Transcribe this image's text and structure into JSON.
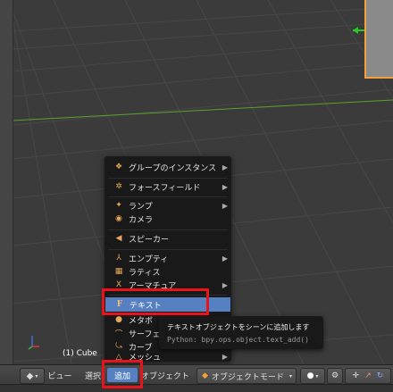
{
  "viewport": {
    "object_label": "(1) Cube",
    "colors": {
      "background": "#3b3b3b",
      "grid": "#4a4a4a",
      "x_axis": "#5aa32a",
      "selected_outline": "#f2a03a"
    }
  },
  "add_menu": {
    "items": [
      {
        "label": "グループのインスタンス",
        "icon": "group-icon",
        "glyph": "❖",
        "submenu": true
      },
      {
        "label": "フォースフィールド",
        "icon": "force-field-icon",
        "glyph": "✲",
        "submenu": true
      },
      {
        "label": "ランプ",
        "icon": "lamp-icon",
        "glyph": "✦",
        "submenu": true
      },
      {
        "label": "カメラ",
        "icon": "camera-icon",
        "glyph": "◉",
        "submenu": false
      },
      {
        "label": "スピーカー",
        "icon": "speaker-icon",
        "glyph": "◀",
        "submenu": false
      },
      {
        "label": "エンプティ",
        "icon": "empty-icon",
        "glyph": "⅄",
        "submenu": true
      },
      {
        "label": "ラティス",
        "icon": "lattice-icon",
        "glyph": "▦",
        "submenu": false
      },
      {
        "label": "アーマチュア",
        "icon": "armature-icon",
        "glyph": "Ⅹ",
        "submenu": true
      },
      {
        "label": "テキスト",
        "icon": "text-icon",
        "glyph": "F",
        "submenu": false,
        "highlighted": true
      },
      {
        "label": "メタボ",
        "icon": "metaball-icon",
        "glyph": "●",
        "submenu": true
      },
      {
        "label": "サーフェ",
        "icon": "surface-icon",
        "glyph": "⌒",
        "submenu": true
      },
      {
        "label": "カーブ",
        "icon": "curve-icon",
        "glyph": "⤿",
        "submenu": true
      },
      {
        "label": "メッシュ",
        "icon": "mesh-icon",
        "glyph": "△",
        "submenu": true
      }
    ]
  },
  "tooltip": {
    "title": "テキストオブジェクトをシーンに追加します",
    "python": "Python: bpy.ops.object.text_add()"
  },
  "header": {
    "view_label": "ビュー",
    "select_label": "選択",
    "add_label": "追加",
    "object_label": "オブジェクト",
    "mode_label": "オブジェクトモード",
    "colors": {
      "active": "#5680c2"
    }
  },
  "annotation": {
    "color": "#e8131b"
  }
}
